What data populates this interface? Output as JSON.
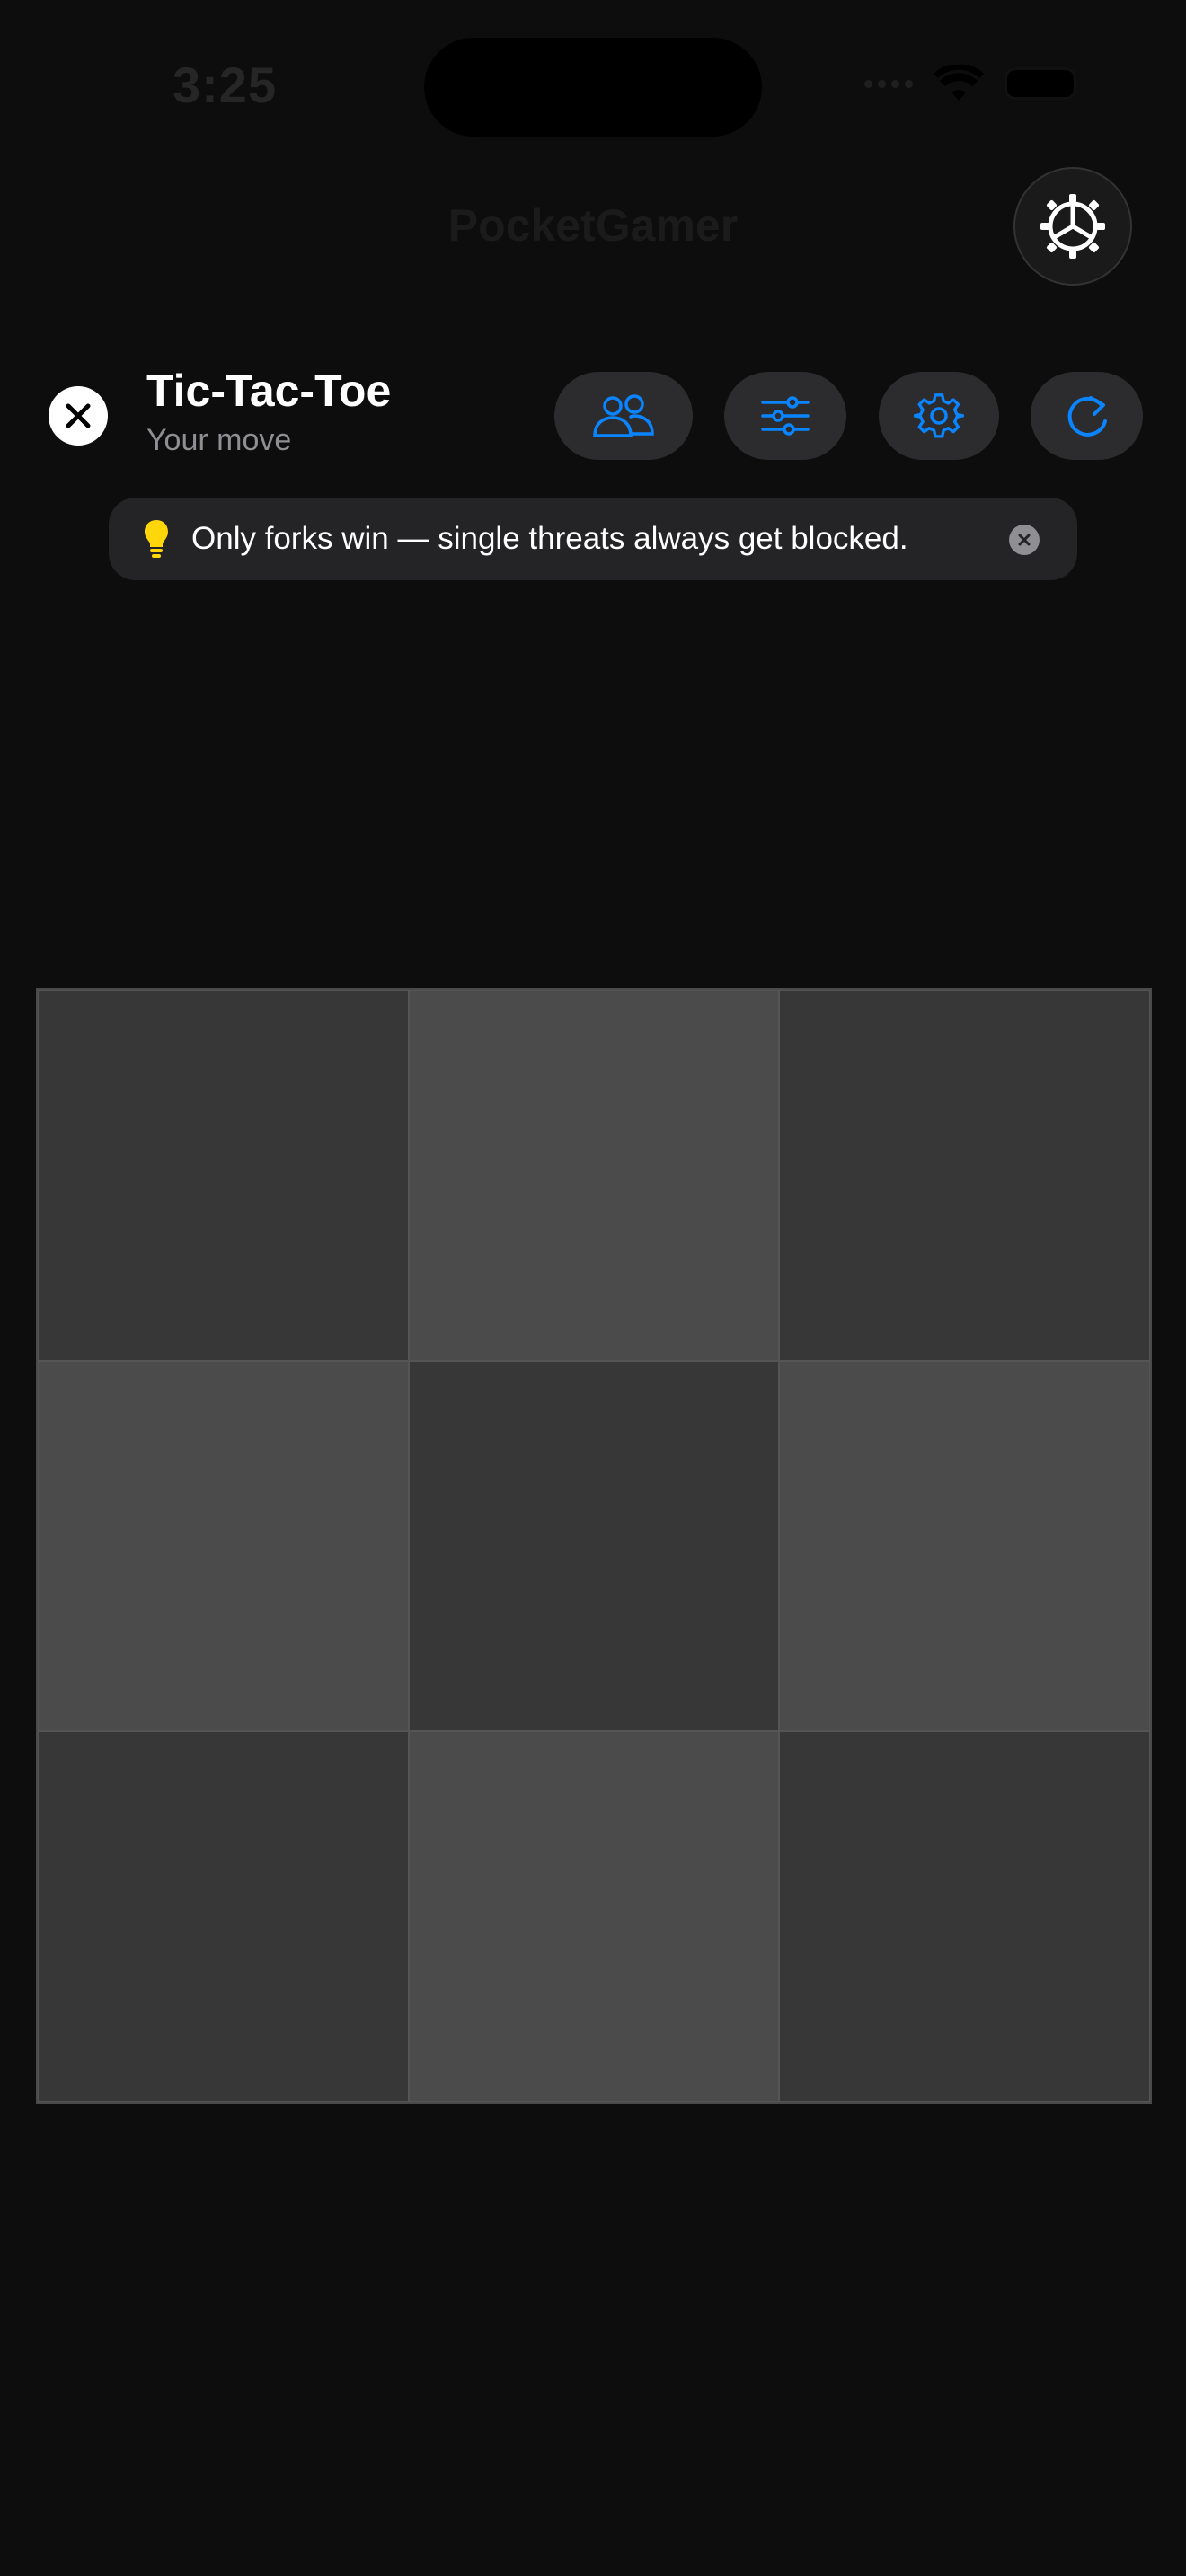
{
  "status_bar": {
    "time": "3:25"
  },
  "app": {
    "title": "PocketGamer"
  },
  "header": {
    "close_icon": "close-icon",
    "title": "Tic-Tac-Toe",
    "subtitle": "Your move",
    "actions": [
      {
        "name": "players-button",
        "icon": "people-icon"
      },
      {
        "name": "options-button",
        "icon": "sliders-icon"
      },
      {
        "name": "settings-button",
        "icon": "gear-icon"
      },
      {
        "name": "restart-button",
        "icon": "restart-icon"
      }
    ]
  },
  "hint": {
    "icon": "lightbulb-icon",
    "text": "Only forks win — single threats always get blocked."
  },
  "board": {
    "rows": 3,
    "cols": 3,
    "cells": [
      "",
      "",
      "",
      "",
      "",
      "",
      "",
      "",
      ""
    ]
  },
  "colors": {
    "background": "#0d0d0d",
    "accent": "#0a84ff",
    "hint_bulb": "#ffd60a",
    "cell_dark": "#373737",
    "cell_light": "#4b4b4b",
    "pill": "#2c2c2e"
  }
}
